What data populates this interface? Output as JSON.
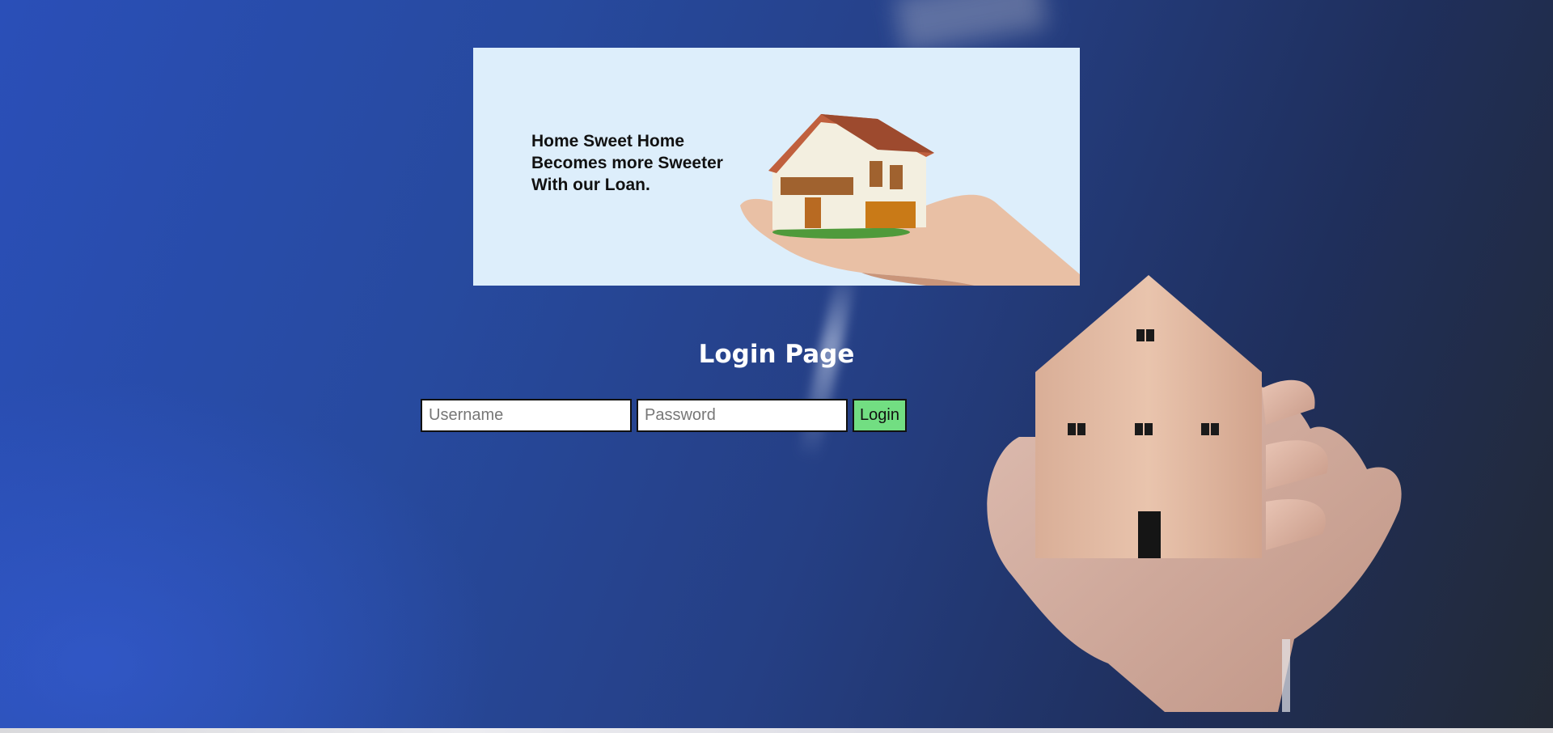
{
  "banner": {
    "tagline": [
      "Home Sweet Home",
      "Becomes more Sweeter",
      "With our Loan."
    ]
  },
  "login": {
    "title": "Login Page",
    "username_placeholder": "Username",
    "password_placeholder": "Password",
    "button_label": "Login"
  },
  "colors": {
    "background": "#274a9f",
    "banner_bg": "#ddeefb",
    "login_button": "#72de82"
  }
}
